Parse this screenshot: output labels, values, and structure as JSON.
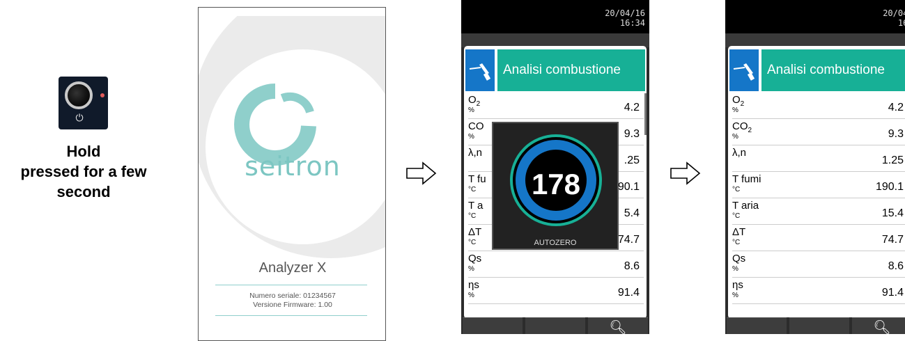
{
  "step1": {
    "instruction": "Hold\npressed for a few\nsecond"
  },
  "splash": {
    "brand": "seitron",
    "model": "Analyzer X",
    "serial": "Numero seriale: 01234567",
    "firmware": "Versione Firmware: 1.00"
  },
  "device": {
    "date": "20/04/16",
    "time": "16:34",
    "title": "Analisi combustione",
    "rows": [
      {
        "label": "O",
        "sub": "2",
        "unit": "%",
        "value": "4.2"
      },
      {
        "label": "CO",
        "sub": "2",
        "unit": "%",
        "value": "9.3"
      },
      {
        "label": "λ,n",
        "sub": "",
        "unit": "",
        "value": "1.25"
      },
      {
        "label": "T fumi",
        "sub": "",
        "unit": "°C",
        "value": "190.1"
      },
      {
        "label": "T aria",
        "sub": "",
        "unit": "°C",
        "value": "15.4"
      },
      {
        "label": "ΔT",
        "sub": "",
        "unit": "°C",
        "value": "74.7"
      },
      {
        "label": "Qs",
        "sub": "",
        "unit": "%",
        "value": "8.6"
      },
      {
        "label": "ηs",
        "sub": "",
        "unit": "%",
        "value": "91.4"
      }
    ]
  },
  "overlay": {
    "count": "178",
    "label": "AUTOZERO",
    "visible_rows": [
      {
        "label": "O",
        "sub": "2",
        "unit": "%",
        "value": "4.2"
      },
      {
        "label": "CO",
        "sub": "",
        "unit": "%",
        "value": "9.3"
      },
      {
        "label": "λ,n",
        "sub": "",
        "unit": "",
        "value": ".25"
      },
      {
        "label": "T fu",
        "sub": "",
        "unit": "°C",
        "value": "90.1"
      },
      {
        "label": "T a",
        "sub": "",
        "unit": "°C",
        "value": "5.4"
      },
      {
        "label": "ΔT",
        "sub": "",
        "unit": "°C",
        "value": "74.7"
      },
      {
        "label": "Qs",
        "sub": "",
        "unit": "%",
        "value": "8.6"
      },
      {
        "label": "ηs",
        "sub": "",
        "unit": "%",
        "value": "91.4"
      }
    ]
  },
  "icons": {
    "power": "power-icon",
    "probe": "probe-icon",
    "zoom": "zoom-in-icon",
    "arrow": "arrow-right-icon"
  },
  "colors": {
    "header_green": "#17b096",
    "header_blue": "#1576c8",
    "brand_teal": "#7cc6c2"
  }
}
